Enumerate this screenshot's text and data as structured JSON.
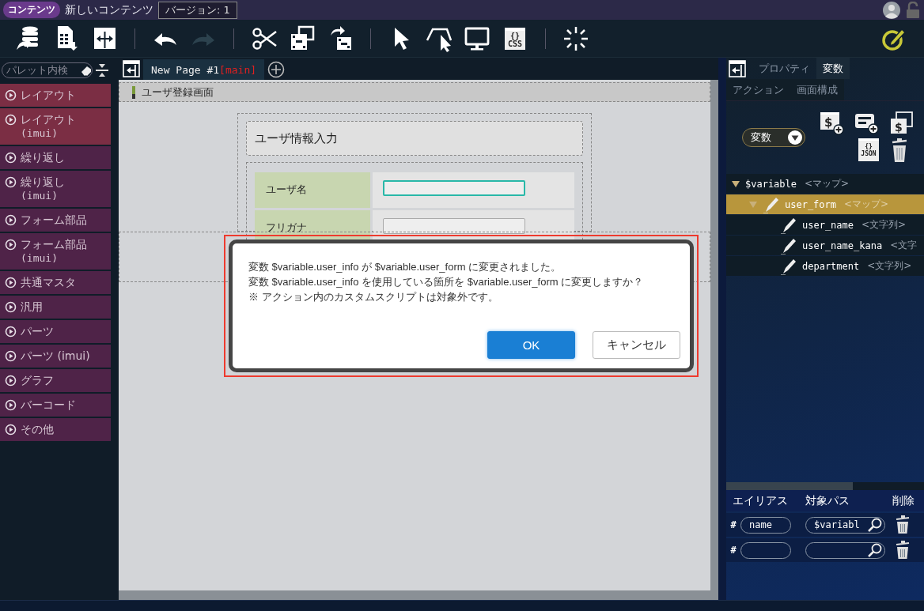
{
  "header": {
    "badge": "コンテンツ",
    "title": "新しいコンテンツ",
    "version": "バージョン: 1"
  },
  "toolbar": [
    {
      "kind": "database",
      "disabled": false
    },
    {
      "kind": "sheet",
      "disabled": false
    },
    {
      "kind": "split",
      "disabled": false
    },
    {
      "kind": "separator"
    },
    {
      "kind": "undo",
      "disabled": false
    },
    {
      "kind": "redo",
      "disabled": true
    },
    {
      "kind": "separator"
    },
    {
      "kind": "scissors",
      "disabled": false
    },
    {
      "kind": "copy",
      "disabled": false
    },
    {
      "kind": "move",
      "disabled": false
    },
    {
      "kind": "separator"
    },
    {
      "kind": "pointer",
      "disabled": false
    },
    {
      "kind": "hover",
      "disabled": false
    },
    {
      "kind": "monitor",
      "disabled": false
    },
    {
      "kind": "css",
      "glyph": "{}",
      "label": "CSS",
      "disabled": false
    },
    {
      "kind": "separator"
    },
    {
      "kind": "loading",
      "disabled": false
    }
  ],
  "palette": {
    "search_placeholder": "パレット内検",
    "categories": [
      {
        "label": "レイアウト",
        "color": "#7b2e44"
      },
      {
        "label": "レイアウト",
        "sub": "(imui)",
        "color": "#7b2e44"
      },
      {
        "label": "繰り返し",
        "color": "#4f2348"
      },
      {
        "label": "繰り返し",
        "sub": "(imui)",
        "color": "#4f2348"
      },
      {
        "label": "フォーム部品",
        "color": "#4f2348"
      },
      {
        "label": "フォーム部品",
        "sub": "(imui)",
        "color": "#4f2348"
      },
      {
        "label": "共通マスタ",
        "color": "#4f2348"
      },
      {
        "label": "汎用",
        "color": "#4f2348"
      },
      {
        "label": "パーツ",
        "color": "#4f2348"
      },
      {
        "label": "パーツ (imui)",
        "color": "#4f2348"
      },
      {
        "label": "グラフ",
        "color": "#4f2348"
      },
      {
        "label": "バーコード",
        "color": "#4f2348"
      },
      {
        "label": "その他",
        "color": "#4f2348"
      }
    ]
  },
  "canvas": {
    "tab": {
      "label": "New Page #1",
      "tag": "[main]"
    },
    "page_title": "ユーザ登録画面",
    "form": {
      "title": "ユーザ情報入力",
      "fields": [
        {
          "label": "ユーザ名",
          "focused": true
        },
        {
          "label": "フリガナ",
          "focused": false
        }
      ]
    }
  },
  "dialog": {
    "lines": [
      "変数 $variable.user_info が $variable.user_form に変更されました。",
      "変数 $variable.user_info を使用している箇所を $variable.user_form に変更しますか？",
      "※ アクション内のカスタムスクリプトは対象外です。"
    ],
    "buttons": [
      {
        "label": "OK",
        "kind": "primary"
      },
      {
        "label": "キャンセル",
        "kind": "secondary"
      }
    ]
  },
  "right_panel": {
    "tabs": [
      {
        "label": "プロパティ",
        "selected": false
      },
      {
        "label": "変数",
        "selected": true
      },
      {
        "label": "アクション",
        "selected": false
      },
      {
        "label": "画面構成",
        "selected": false
      }
    ],
    "dropdown": "変数",
    "icons": [
      {
        "kind": "add_variable",
        "glyph": "$"
      },
      {
        "kind": "add_field"
      },
      {
        "kind": "copy_variable",
        "glyph": "$"
      },
      {
        "kind": "blank"
      },
      {
        "kind": "json",
        "glyph": "{}",
        "label": "JSON"
      },
      {
        "kind": "delete"
      }
    ],
    "tree": [
      {
        "name": "$variable",
        "type": "<マップ>",
        "kind": "root",
        "expanded": true,
        "selected": false,
        "children": [
          {
            "name": "user_form",
            "type": "<マップ>",
            "kind": "field",
            "expanded": true,
            "selected": true,
            "children": [
              {
                "name": "user_name",
                "type": "<文字列>",
                "kind": "field",
                "selected": false
              },
              {
                "name": "user_name_kana",
                "type": "<文字",
                "kind": "field",
                "selected": false
              },
              {
                "name": "department",
                "type": "<文字列>",
                "kind": "field",
                "selected": false
              }
            ]
          }
        ]
      }
    ],
    "alias_table": {
      "columns": [
        "エイリアス",
        "対象パス",
        "削除"
      ],
      "rows": [
        {
          "prefix": "#",
          "alias": "name",
          "path": "$variabl"
        },
        {
          "prefix": "#"
        }
      ]
    }
  }
}
